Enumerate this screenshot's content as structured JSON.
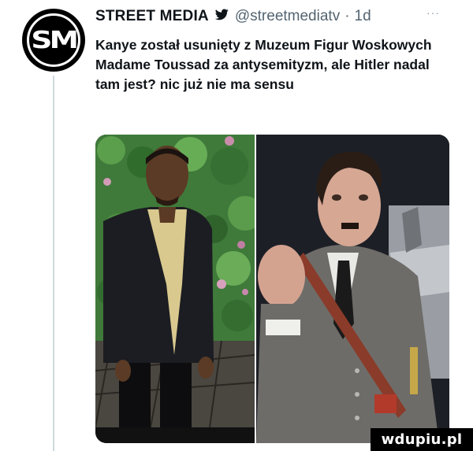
{
  "tweet": {
    "author_name": "STREET MEDIA",
    "handle": "@streetmediatv",
    "separator": "·",
    "time": "1d",
    "more_label": "···",
    "avatar_text": "SM",
    "text": "Kanye został usunięty z Muzeum Figur Woskowych Madame Toussad za antysemityzm, ale Hitler nadal tam jest? nic już nie ma sensu"
  },
  "icons": {
    "verified": "twitter-bird-icon",
    "more": "more-options-icon"
  },
  "watermark": {
    "text": "wdupiu.pl"
  },
  "colors": {
    "text_primary": "#0f1419",
    "text_secondary": "#536471",
    "thread_line": "#cfd9de",
    "avatar_bg": "#000000"
  }
}
